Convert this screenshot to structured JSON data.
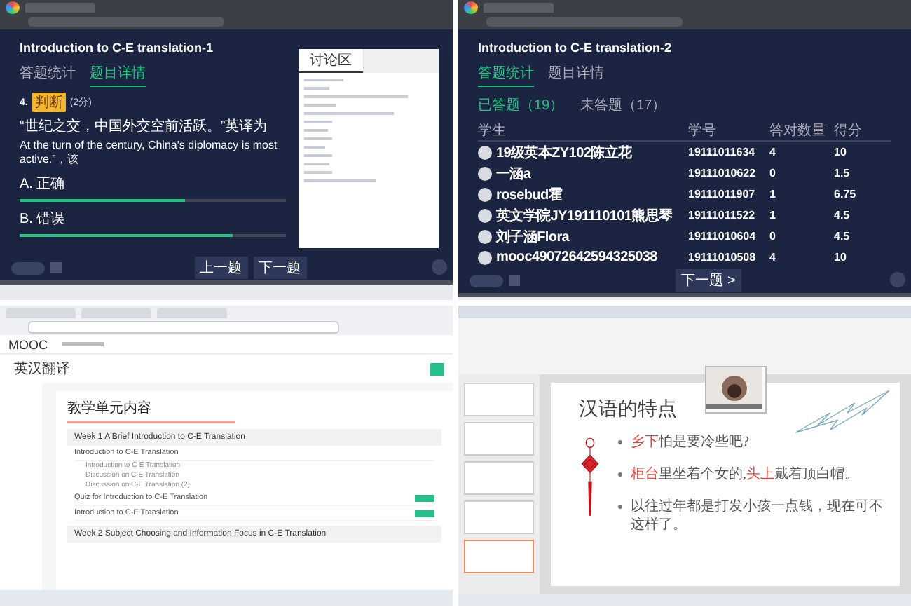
{
  "live_quiz_1": {
    "title": "Introduction to C-E translation-1",
    "tabs": [
      {
        "label": "答题统计",
        "selected": false
      },
      {
        "label": "题目详情",
        "selected": true
      }
    ],
    "question": {
      "number": "4.",
      "badge": "判断",
      "points": "(2分)",
      "text_zh": "“世纪之交，中国外交空前活跃。”英译为",
      "text_en": "At the turn of the century, China's diplomacy is most active.”，该"
    },
    "options": [
      {
        "label": "A. 正确",
        "level": 0.62
      },
      {
        "label": "B. 错误",
        "level": 0.8
      }
    ],
    "chat": {
      "tabs": [
        {
          "label": "讨论区",
          "selected": true
        }
      ]
    },
    "nav_buttons": [
      "上一题",
      "下一题"
    ]
  },
  "live_quiz_2": {
    "title": "Introduction to C-E translation-2",
    "tabs": [
      {
        "label": "答题统计",
        "selected": true
      },
      {
        "label": "题目详情",
        "selected": false
      }
    ],
    "filters": [
      {
        "label": "已答题（19）",
        "selected": true
      },
      {
        "label": "未答题（17）",
        "selected": false
      }
    ],
    "table": {
      "columns": [
        "学生",
        "学号",
        "答对数量",
        "得分"
      ],
      "rows": [
        [
          "19级英本ZY102陈立花",
          "19111011634",
          "4",
          "10"
        ],
        [
          "一涵a",
          "19111010622",
          "0",
          "1.5"
        ],
        [
          "rosebud霍",
          "19111011907",
          "1",
          "6.75"
        ],
        [
          "英文学院JY191110101熊思琴",
          "19111011522",
          "1",
          "4.5"
        ],
        [
          "刘子涵Flora",
          "19111010604",
          "0",
          "4.5"
        ],
        [
          "mooc49072642594325038",
          "19111010508",
          "4",
          "10"
        ]
      ]
    },
    "next_button": "下一题 >"
  },
  "mooc_page": {
    "logo": "MOOC",
    "course": "英汉翻译",
    "section_title": "教学单元内容",
    "weeks": [
      {
        "title": "Week 1 A Brief Introduction to C-E Translation",
        "items": [
          {
            "kind": "lesson",
            "title": "Introduction to C-E Translation",
            "children": [
              "Introduction to C-E Translation",
              "Discussion on C-E Translation",
              "Discussion on C-E Translation (2)"
            ]
          },
          {
            "kind": "quiz",
            "title": "Quiz for Introduction to C-E Translation"
          },
          {
            "kind": "quiz",
            "title": "Introduction to C-E Translation"
          }
        ]
      },
      {
        "title": "Week 2 Subject Choosing and Information Focus in C-E Translation"
      }
    ]
  },
  "presentation": {
    "slide_title": "汉语的特点",
    "bullets": [
      [
        {
          "text": "乡下",
          "highlight": true
        },
        {
          "text": "怕是要冷些吧?",
          "highlight": false
        }
      ],
      [
        {
          "text": "柜台",
          "highlight": true
        },
        {
          "text": "里坐着个女的,",
          "highlight": false
        },
        {
          "text": "头上",
          "highlight": true
        },
        {
          "text": "戴着顶白帽。",
          "highlight": false
        }
      ],
      [
        {
          "text": "以往过年都是打发小孩一点钱，现在可不这样了。",
          "highlight": false
        }
      ]
    ]
  }
}
